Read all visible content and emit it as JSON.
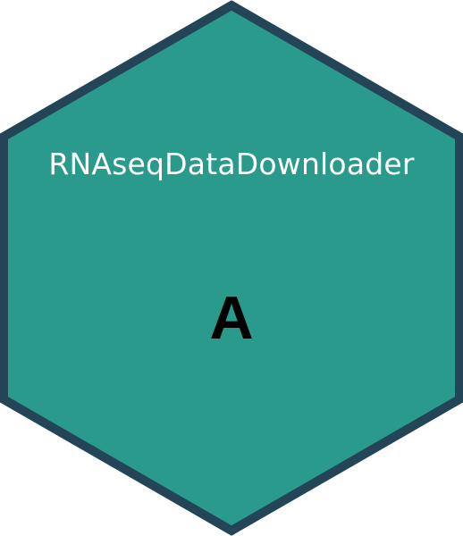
{
  "logo": {
    "title": "RNAseqDataDownloader",
    "badge": "A",
    "fill_color": "#2a9a8c",
    "border_color": "#244557"
  }
}
